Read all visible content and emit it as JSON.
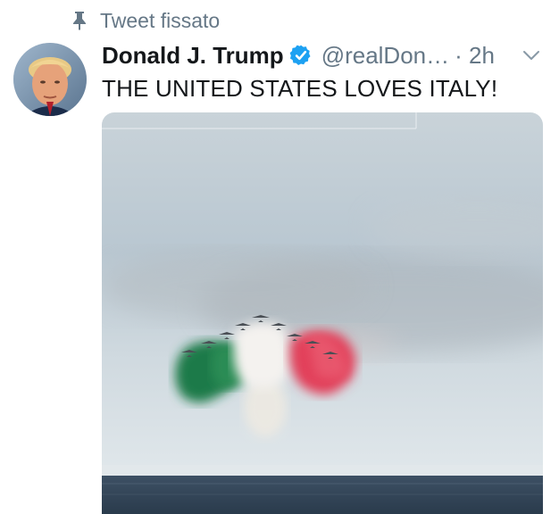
{
  "pinned": {
    "label": "Tweet fissato",
    "icon": "pin-icon"
  },
  "tweet": {
    "author": {
      "display_name": "Donald J. Trump",
      "handle": "@realDon…",
      "verified": true,
      "verified_icon": "verified-badge-icon",
      "avatar": "profile-avatar"
    },
    "time": "· 2h",
    "more_icon": "chevron-down-icon",
    "text": "THE UNITED STATES LOVES ITALY!",
    "media": {
      "kind": "video",
      "description_icon": "aircraft-formation-image"
    }
  },
  "colors": {
    "text_primary": "#14171a",
    "text_secondary": "#657786",
    "verified": "#1da1f2",
    "smoke_green": "#1f7a4a",
    "smoke_white": "#f2f0ee",
    "smoke_red": "#e2405a",
    "sea": "#2c3f52"
  }
}
